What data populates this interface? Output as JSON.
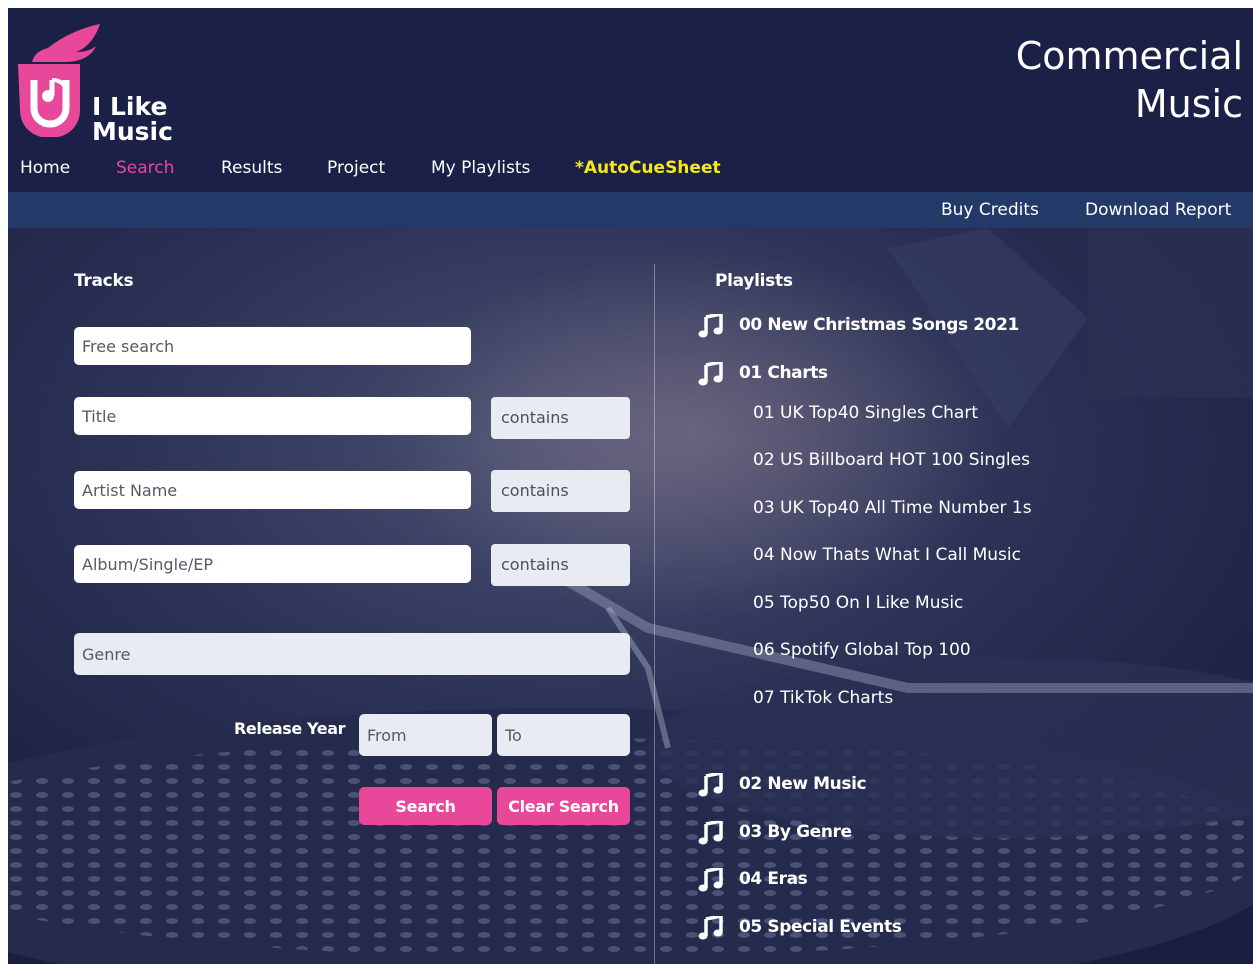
{
  "brand": {
    "logo_line1": "I Like",
    "logo_line2": "Music",
    "title_line1": "Commercial",
    "title_line2": "Music",
    "accent_color": "#e8489a",
    "highlight_color": "#f6e71c"
  },
  "nav": {
    "items": [
      {
        "label": "Home"
      },
      {
        "label": "Search"
      },
      {
        "label": "Results"
      },
      {
        "label": "Project"
      },
      {
        "label": "My Playlists"
      },
      {
        "label": "*AutoCueSheet"
      }
    ],
    "active": "Search"
  },
  "subnav": {
    "buy_credits": "Buy Credits",
    "download_report": "Download Report"
  },
  "tracks": {
    "heading": "Tracks",
    "free_search_placeholder": "Free search",
    "title_placeholder": "Title",
    "title_match": "contains",
    "artist_placeholder": "Artist Name",
    "artist_match": "contains",
    "album_placeholder": "Album/Single/EP",
    "album_match": "contains",
    "genre_placeholder": "Genre",
    "release_year_label": "Release Year",
    "from_placeholder": "From",
    "to_placeholder": "To",
    "search_button": "Search",
    "clear_button": "Clear Search"
  },
  "playlists": {
    "heading": "Playlists",
    "icon": "music-note-icon",
    "top": [
      {
        "label": "00 New Christmas Songs 2021"
      },
      {
        "label": "01 Charts"
      },
      {
        "label": "02 New Music"
      },
      {
        "label": "03 By Genre"
      },
      {
        "label": "04 Eras"
      },
      {
        "label": "05 Special Events"
      }
    ],
    "charts_children": [
      {
        "label": "01 UK Top40 Singles Chart"
      },
      {
        "label": "02 US Billboard HOT 100 Singles"
      },
      {
        "label": "03 UK Top40 All Time Number 1s"
      },
      {
        "label": "04 Now Thats What I Call Music"
      },
      {
        "label": "05 Top50 On I Like Music"
      },
      {
        "label": "06 Spotify Global Top 100"
      },
      {
        "label": "07 TikTok Charts"
      }
    ]
  }
}
